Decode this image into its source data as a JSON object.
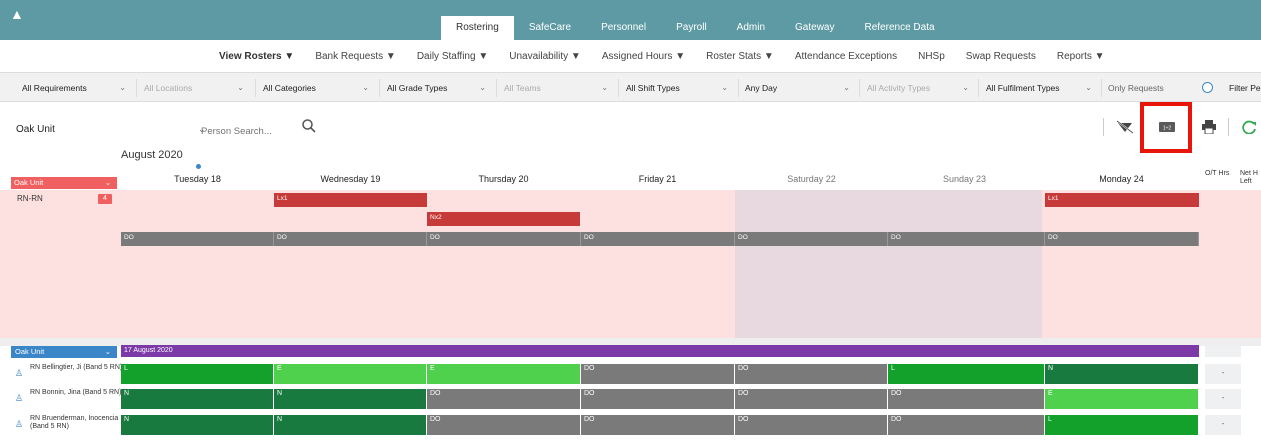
{
  "app": {
    "colors": {
      "topbar": "#5e9aa3",
      "req_bg": "#fde0e0",
      "weekend_bg": "#e8d9e1",
      "red": "#c73a3a",
      "purple": "#7b3aa8",
      "blue": "#3a86c8",
      "highlight": "#e8150b"
    }
  },
  "topnav": {
    "collapse_icon": "▲",
    "tabs": [
      "Rostering",
      "SafeCare",
      "Personnel",
      "Payroll",
      "Admin",
      "Gateway",
      "Reference Data"
    ]
  },
  "subnav": {
    "items": [
      "View Rosters ▼",
      "Bank Requests ▼",
      "Daily Staffing ▼",
      "Unavailability ▼",
      "Assigned Hours ▼",
      "Roster Stats ▼",
      "Attendance Exceptions",
      "NHSp",
      "Swap Requests",
      "Reports ▼"
    ]
  },
  "filters": {
    "requirements": "All Requirements",
    "locations": "All Locations",
    "categories": "All Categories",
    "grade_types": "All Grade Types",
    "teams": "All Teams",
    "shift_types": "All Shift Types",
    "day": "Any Day",
    "activity_types": "All Activity Types",
    "fulfilment_types": "All Fulfilment Types",
    "only_requests": "Only Requests",
    "filter_people": "Filter Pe"
  },
  "toolbar": {
    "unit": "Oak Unit",
    "person_search_placeholder": "Person Search...",
    "icons": [
      "eye-off-icon",
      "shift-length-icon",
      "print-icon",
      "refresh-icon"
    ]
  },
  "calendar": {
    "month": "August 2020",
    "days": [
      "Tuesday 18",
      "Wednesday 19",
      "Thursday 20",
      "Friday 21",
      "Saturday 22",
      "Sunday 23",
      "Monday 24"
    ],
    "ot_hrs": "O/T Hrs",
    "net_hrs_left": "Net H Left"
  },
  "requirements_panel": {
    "unit_label": "Oak Unit",
    "row_label": "RN-RN",
    "row_count": "4",
    "bars": [
      {
        "label": "Lx1",
        "kind": "red"
      },
      {
        "label": "Nx2",
        "kind": "red"
      },
      {
        "label": "Lx1",
        "kind": "red"
      }
    ],
    "do_label": "DO"
  },
  "roster_panel": {
    "unit_label": "Oak Unit",
    "week_label": "17 August 2020",
    "staff": [
      {
        "name": "RN Bellingtier, Ji (Band 5 RN)",
        "shifts": [
          "L",
          "E",
          "E",
          "DO",
          "DO",
          "L",
          "N"
        ],
        "hrs": "-"
      },
      {
        "name": "RN Bonnin, Jina (Band 5 RN)",
        "shifts": [
          "N",
          "N",
          "DO",
          "DO",
          "DO",
          "DO",
          "E"
        ],
        "hrs": "-"
      },
      {
        "name": "RN Bruenderman, Inocencia (Band 5 RN)",
        "shifts": [
          "N",
          "N",
          "DO",
          "DO",
          "DO",
          "DO",
          "L"
        ],
        "hrs": "-"
      }
    ]
  }
}
